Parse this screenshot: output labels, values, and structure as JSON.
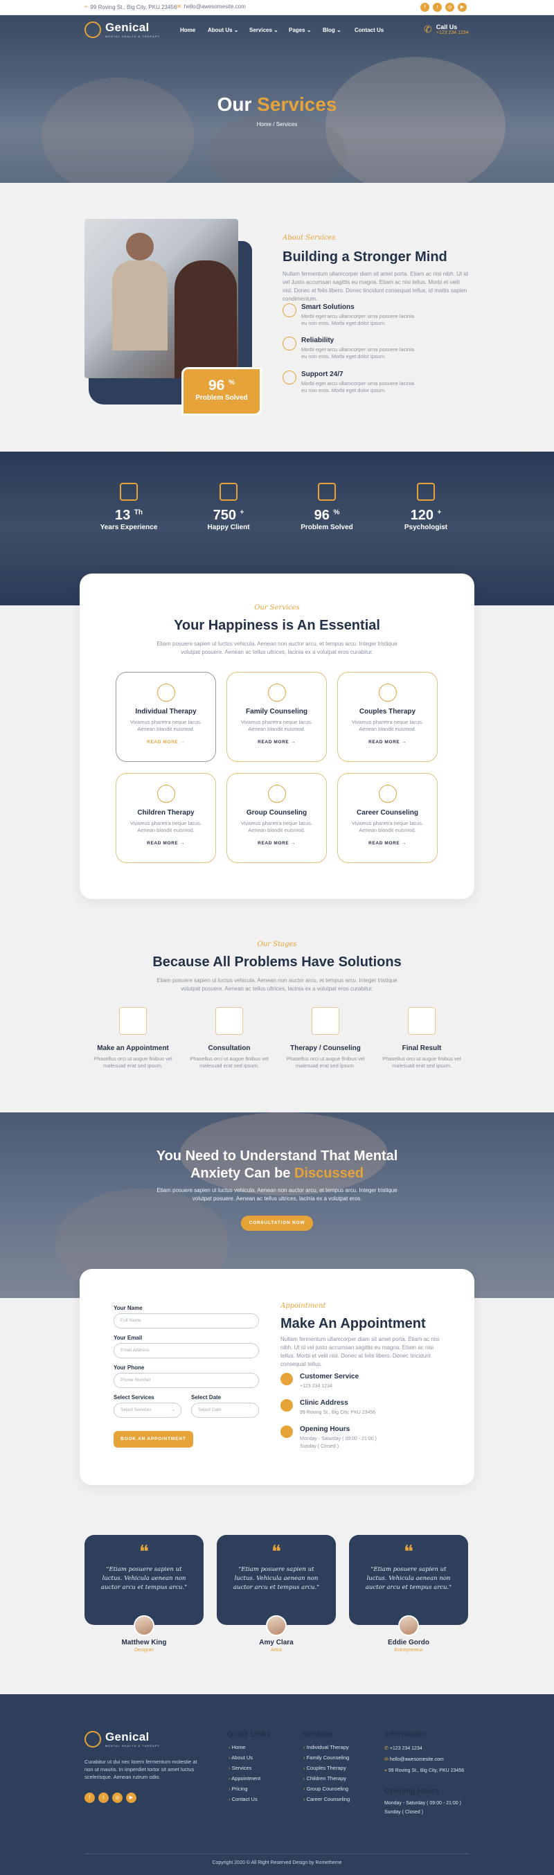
{
  "topbar": {
    "address": "99 Roving St., Big City, PKU 23456",
    "email": "hello@awesomesite.com",
    "social_icons": [
      "facebook-icon",
      "twitter-icon",
      "instagram-icon",
      "youtube-icon"
    ]
  },
  "nav": {
    "brand": "Genical",
    "tagline": "MENTAL HEALTH & THERAPY",
    "links": [
      "Home",
      "About Us",
      "Services",
      "Pages",
      "Blog",
      "Contact Us"
    ],
    "call_label": "Call Us",
    "call_number": "+123 234 1234"
  },
  "hero": {
    "title_plain": "Our ",
    "title_accent": "Services",
    "breadcrumb": "Home / Services"
  },
  "about": {
    "subtitle": "About Services",
    "title": "Building a Stronger Mind",
    "text": "Nullam fermentum ullamcorper diam sit amet porta. Etiam ac nisi nibh. Ut id vel Justo accumsan sagittis eu magna. Etiam ac nisi tellus. Morbi et velit nisl. Donec at felis libero. Donec tincidunt consequat tellus, id mattis sapien condimentum.",
    "badge_value": "96",
    "badge_unit": "%",
    "badge_label": "Problem Solved",
    "features": [
      {
        "title": "Smart Solutions",
        "text": "Morbi eget arcu ullamcorper urna posuere lacinia eu non eros. Morbi eget dolor ipsum."
      },
      {
        "title": "Reliability",
        "text": "Morbi eget arcu ullamcorper urna posuere lacinia eu non eros. Morbi eget dolor ipsum."
      },
      {
        "title": "Support 24/7",
        "text": "Morbi eget arcu ullamcorper urna posuere lacinia eu non eros. Morbi eget dolor ipsum."
      }
    ]
  },
  "stats": [
    {
      "value": "13",
      "suffix": "Th",
      "label": "Years Experience"
    },
    {
      "value": "750",
      "suffix": "+",
      "label": "Happy Client"
    },
    {
      "value": "96",
      "suffix": "%",
      "label": "Problem Solved"
    },
    {
      "value": "120",
      "suffix": "+",
      "label": "Psychologist"
    }
  ],
  "services": {
    "subtitle": "Our Services",
    "title": "Your Happiness is An Essential",
    "text1": "Etiam posuere sapien ut luctus vehicula. Aenean non auctor arcu, et tempus arcu. Integer tristique",
    "text2": "volutpat posuere. Aenean ac tellus ultrices, lacinia ex a volutpat eros curabitur.",
    "items": [
      {
        "title": "Individual Therapy",
        "text": "Vivamus pharetra neque lacus. Aenean blandit euismod.",
        "link": "READ MORE"
      },
      {
        "title": "Family Counseling",
        "text": "Vivamus pharetra neque lacus. Aenean blandit euismod.",
        "link": "READ MORE"
      },
      {
        "title": "Couples Therapy",
        "text": "Vivamus pharetra neque lacus. Aenean blandit euismod.",
        "link": "READ MORE"
      },
      {
        "title": "Children Therapy",
        "text": "Vivamus pharetra neque lacus. Aenean blandit euismod.",
        "link": "READ MORE"
      },
      {
        "title": "Group Counseling",
        "text": "Vivamus pharetra neque lacus. Aenean blandit euismod.",
        "link": "READ MORE"
      },
      {
        "title": "Career Counseling",
        "text": "Vivamus pharetra neque lacus. Aenean blandit euismod.",
        "link": "READ MORE"
      }
    ]
  },
  "stages": {
    "subtitle": "Our Stages",
    "title": "Because All Problems Have Solutions",
    "text1": "Etiam posuere sapien ut luctus vehicula. Aenean non auctor arcu, et tempus arcu. Integer tristique",
    "text2": "volutpat posuere. Aenean ac tellus ultrices, lacinia ex a volutpat eros curabitur.",
    "items": [
      {
        "title": "Make an Appointment",
        "text1": "Phasellus orci ut augue finibus vel",
        "text2": "malesuad erat sed ipsum."
      },
      {
        "title": "Consultation",
        "text1": "Phasellus orci ut augue finibus vel",
        "text2": "malesuad erat sed ipsum."
      },
      {
        "title": "Therapy / Counseling",
        "text1": "Phasellus orci ut augue finibus vel",
        "text2": "malesuad erat sed ipsum."
      },
      {
        "title": "Final Result",
        "text1": "Phasellus orci ut augue finibus vel",
        "text2": "malesuad erat sed ipsum."
      }
    ]
  },
  "cta": {
    "line1": "You Need to Understand That Mental",
    "line2_plain": "Anxiety Can be ",
    "line2_accent": "Discussed",
    "text1": "Etiam posuere sapien ut luctus vehicula. Aenean non auctor arcu, et tempus arcu. Integer tristique",
    "text2": "volutpat posuere. Aenean ac tellus ultrices, lacinia ex a volutpat eros.",
    "button": "CONSULTATION NOW"
  },
  "appointment": {
    "form": {
      "name_label": "Your Name",
      "name_placeholder": "Full Name",
      "email_label": "Your Email",
      "email_placeholder": "Email Address",
      "phone_label": "Your Phone",
      "phone_placeholder": "Phone Number",
      "service_label": "Select Services",
      "service_value": "Select Services",
      "date_label": "Select Date",
      "date_placeholder": "Select Date",
      "submit": "BOOK AN APPOINTMENT"
    },
    "subtitle": "Appointment",
    "title": "Make An Appointment",
    "text": "Nullam fermentum ullamcorper diam sit amet porta. Etiam ac nisi nibh. Ut id vel justo accumsan sagittis eu magna. Etiam ac nisi tellus. Morbi et velit nisl. Donec at felis libero. Donec tincidunt consequat tellus.",
    "contacts": [
      {
        "title": "Customer Service",
        "text": "+123 234 1234",
        "text2": ""
      },
      {
        "title": "Clinic Address",
        "text": "99 Roving St., Big City, PKU 23456",
        "text2": ""
      },
      {
        "title": "Opening Hours",
        "text": "Monday - Saturday ( 09:00 - 21:00 )",
        "text2": "Sunday ( Closed )"
      }
    ]
  },
  "testimonials": [
    {
      "quote": "\"Etiam posuere sapien ut luctus. Vehicula aenean non auctor arcu et tempus arcu.\"",
      "name": "Matthew King",
      "role": "Designer"
    },
    {
      "quote": "\"Etiam posuere sapien ut luctus. Vehicula aenean non auctor arcu et tempus arcu.\"",
      "name": "Amy Clara",
      "role": "Artist"
    },
    {
      "quote": "\"Etiam posuere sapien ut luctus. Vehicula aenean non auctor arcu et tempus arcu.\"",
      "name": "Eddie Gordo",
      "role": "Entrepreneur"
    }
  ],
  "footer": {
    "brand": "Genical",
    "tagline": "MENTAL HEALTH & THERAPY",
    "about_text": "Curabitur ut dui nec lorem fermentum molestie at non ut mauris. In imperdiet tortor sit amet luctus scelerisque. Aenean rutrum odio.",
    "quick_title": "Quick Links",
    "quick_links": [
      "Home",
      "About Us",
      "Services",
      "Appointment",
      "Pricing",
      "Contact Us"
    ],
    "services_title": "Services",
    "services_links": [
      "Individual Therapy",
      "Family Counseling",
      "Couples Therapy",
      "Children Therapy",
      "Group Counseling",
      "Career Counseling"
    ],
    "info_title": "Information",
    "info_phone": "+123 234 1234",
    "info_email": "hello@awesomesite.com",
    "info_address": "99 Roving St., Big City, PKU 23456",
    "hours_title": "Opening Hours",
    "hours_1": "Monday - Saturday ( 09:00 - 21:00 )",
    "hours_2": "Sunday ( Closed )",
    "copyright": "Copyright 2020 © All Right Reserved Design by Rometheme"
  },
  "colors": {
    "accent": "#e5a33a",
    "navy": "#2d3f5b",
    "background": "#f1f1f1"
  }
}
